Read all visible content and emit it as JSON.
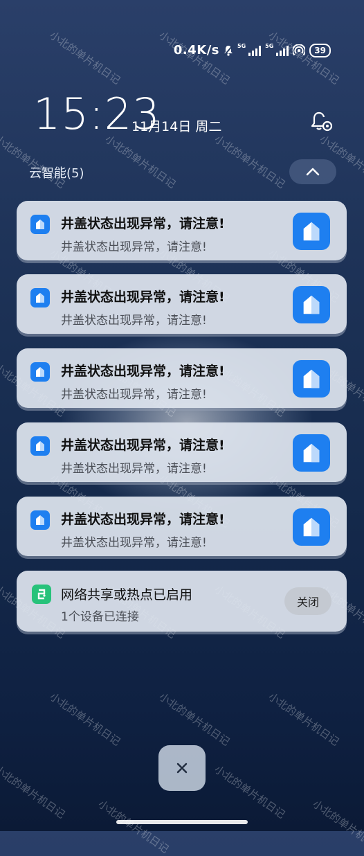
{
  "status_bar": {
    "speed": "0.4K/s",
    "sim1": "5G",
    "sim2": "5G",
    "battery": "39"
  },
  "lockscreen": {
    "time": "15:23",
    "date": "11月14日 周二"
  },
  "notification_group": {
    "title": "云智能(5)"
  },
  "notifications": [
    {
      "title": "井盖状态出现异常，请注意!",
      "body": "井盖状态出现异常，请注意!"
    },
    {
      "title": "井盖状态出现异常，请注意!",
      "body": "井盖状态出现异常，请注意!"
    },
    {
      "title": "井盖状态出现异常，请注意!",
      "body": "井盖状态出现异常，请注意!"
    },
    {
      "title": "井盖状态出现异常，请注意!",
      "body": "井盖状态出现异常，请注意!"
    },
    {
      "title": "井盖状态出现异常，请注意!",
      "body": "井盖状态出现异常，请注意!"
    }
  ],
  "hotspot": {
    "title": "网络共享或热点已启用",
    "body": "1个设备已连接",
    "action": "关闭"
  },
  "watermark": "小北的单片机日记",
  "colors": {
    "app_blue": "#1e7ff0",
    "hotspot_green": "#27c27a",
    "card_bg": "#dee4ee"
  },
  "icons": [
    "bell-muted-icon",
    "signal-icon",
    "wifi-hotspot-icon",
    "battery-icon",
    "notification-settings-icon",
    "chevron-up-icon",
    "app-house-icon",
    "hotspot-icon",
    "close-icon"
  ]
}
